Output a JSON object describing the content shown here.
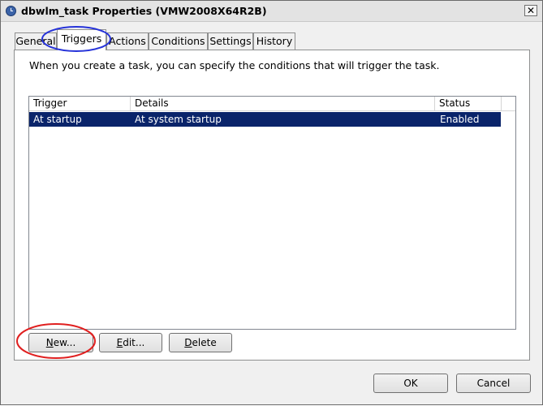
{
  "window": {
    "title": "dbwlm_task Properties (VMW2008X64R2B)",
    "close_glyph": "✕"
  },
  "tabs": [
    {
      "label": "General",
      "selected": false
    },
    {
      "label": "Triggers",
      "selected": true
    },
    {
      "label": "Actions",
      "selected": false
    },
    {
      "label": "Conditions",
      "selected": false
    },
    {
      "label": "Settings",
      "selected": false
    },
    {
      "label": "History",
      "selected": false
    }
  ],
  "triggers_tab": {
    "description": "When you create a task, you can specify the conditions that will trigger the task.",
    "columns": [
      "Trigger",
      "Details",
      "Status"
    ],
    "rows": [
      {
        "trigger": "At startup",
        "details": "At system startup",
        "status": "Enabled",
        "selected": true
      }
    ],
    "buttons": {
      "new": {
        "mnemonic": "N",
        "rest": "ew..."
      },
      "edit": {
        "mnemonic": "E",
        "rest": "dit..."
      },
      "delete": {
        "mnemonic": "D",
        "rest": "elete"
      }
    }
  },
  "dialog_buttons": {
    "ok": "OK",
    "cancel": "Cancel"
  },
  "annotations": {
    "triggers_tab_circle_color": "#2633d9",
    "new_button_circle_color": "#e02020"
  },
  "colors": {
    "selection": "#0a246a",
    "window_bg": "#f0f0f0"
  }
}
